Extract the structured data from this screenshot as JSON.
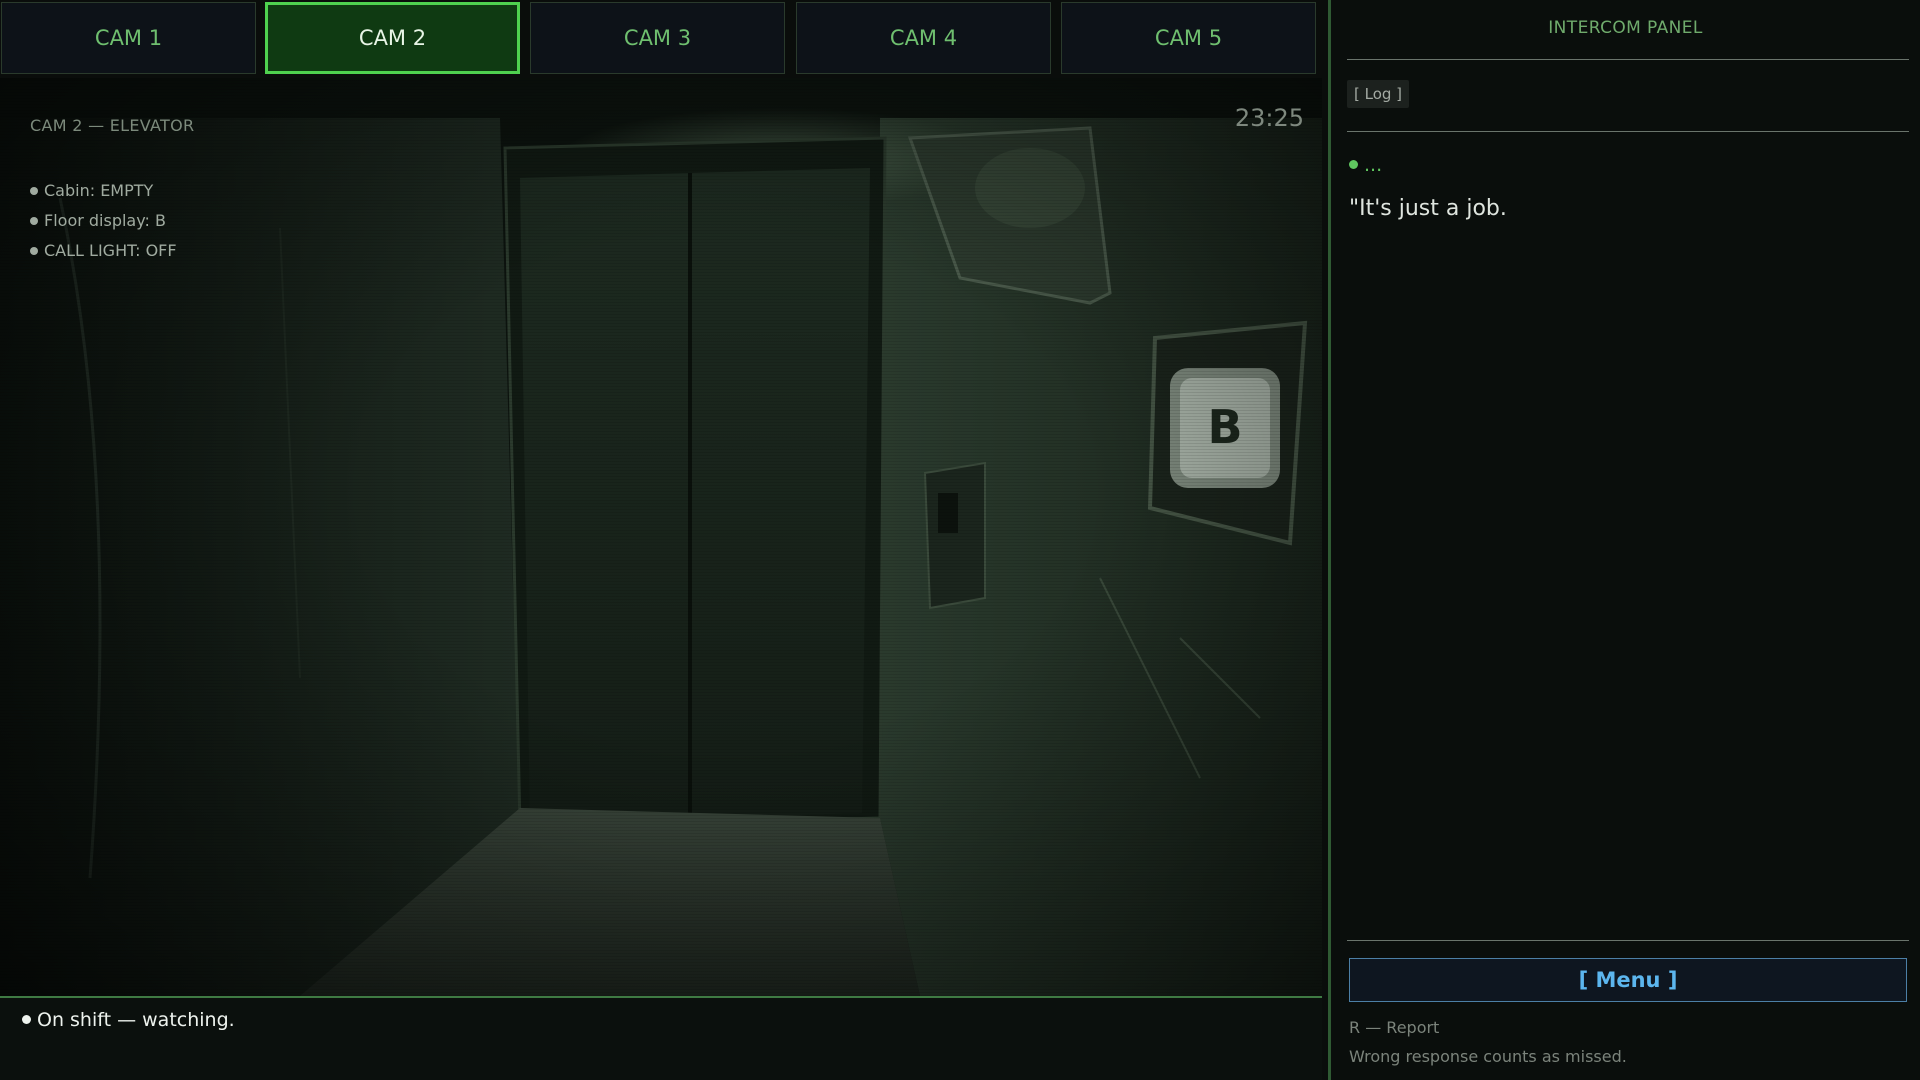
{
  "cameras": [
    {
      "label": "CAM 1",
      "active": false
    },
    {
      "label": "CAM 2",
      "active": true
    },
    {
      "label": "CAM 3",
      "active": false
    },
    {
      "label": "CAM 4",
      "active": false
    },
    {
      "label": "CAM 5",
      "active": false
    }
  ],
  "feed": {
    "location": "CAM 2 — ELEVATOR",
    "time": "23:25",
    "status": [
      "Cabin: EMPTY",
      "Floor display: B",
      "CALL LIGHT: OFF"
    ],
    "floor_indicator": "B"
  },
  "bottom": {
    "status": "On shift — watching."
  },
  "intercom": {
    "title": "INTERCOM PANEL",
    "log_label": "[ Log ]",
    "speaker": "...",
    "dialogue": "\"It's just a job.",
    "menu_label": "[ Menu ]",
    "hint_report": "R — Report",
    "hint_rule": "Wrong response counts as missed."
  },
  "colors": {
    "accent_green": "#4fd14f",
    "active_tab_bg": "#0f3a12",
    "menu_blue": "#5cb6ee"
  }
}
